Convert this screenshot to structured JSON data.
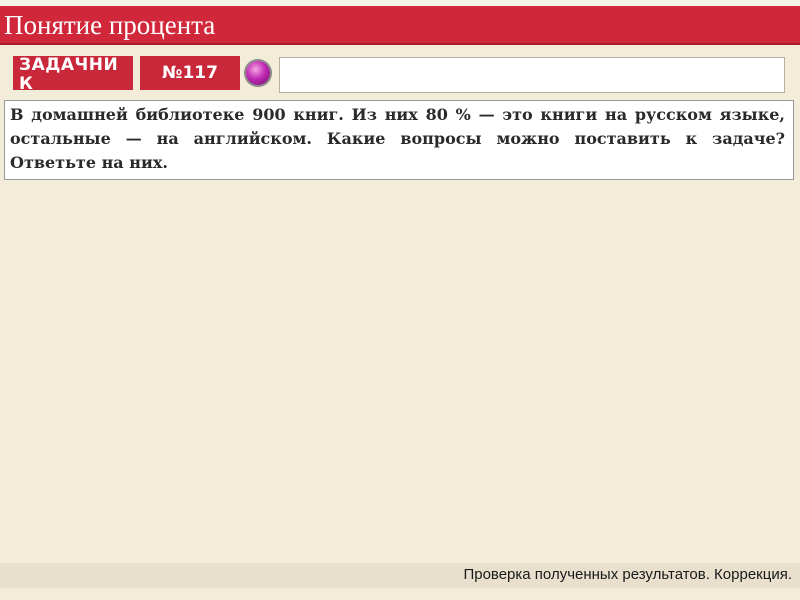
{
  "header": {
    "title": "Понятие процента"
  },
  "toolbar": {
    "tab_zadachnik": "ЗАДАЧНИК",
    "tab_number": "№117",
    "answer_value": "",
    "answer_placeholder": ""
  },
  "problem": {
    "text": "В домашней библиотеке 900 книг. Из них 80 % — это книги на русском языке, остальные — на английском. Какие вопросы можно поставить к задаче? Ответьте на них."
  },
  "footer": {
    "caption": "Проверка полученных результатов. Коррекция."
  },
  "colors": {
    "accent": "#d0283a",
    "background": "#f3ecd8",
    "orb": "#c02bb4"
  },
  "icons": {
    "nav_orb": "magenta-orb-icon"
  }
}
